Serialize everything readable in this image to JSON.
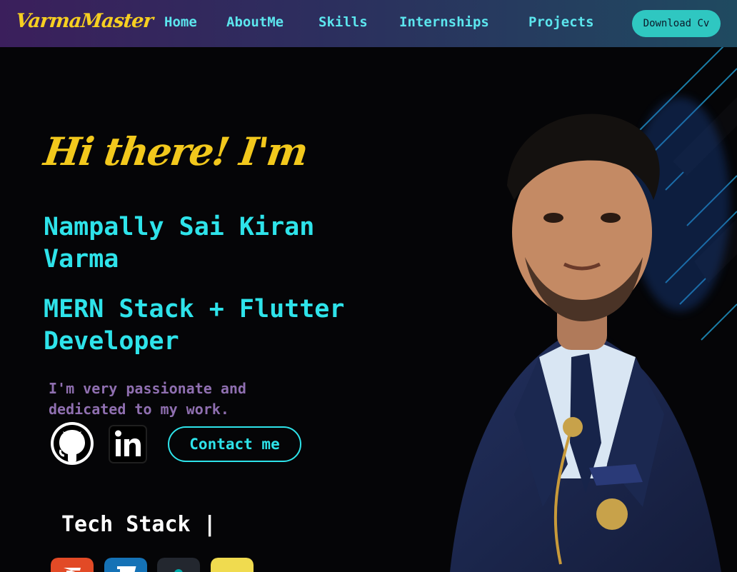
{
  "brand": {
    "logo": "VarmaMaster"
  },
  "nav": {
    "items": [
      "Home",
      "AboutMe",
      "Skills",
      "Internships",
      "Projects"
    ],
    "cv_button": "Download Cv"
  },
  "hero": {
    "greeting": "Hi there! I'm",
    "name": "Nampally Sai Kiran Varma",
    "role": "MERN Stack + Flutter Developer",
    "tagline": "I'm very passionate and dedicated to my work.",
    "contact_button": "Contact me",
    "socials": [
      "github-icon",
      "linkedin-icon"
    ]
  },
  "tech": {
    "title": "Tech Stack |",
    "icons": [
      "html5-icon",
      "css3-icon",
      "dark-icon",
      "javascript-icon"
    ]
  },
  "colors": {
    "accent_cyan": "#2ee3ea",
    "brand_yellow": "#f2c81c",
    "tagline_purple": "#8f6fb0",
    "cv_button": "#2fc7c1",
    "background": "#050507"
  }
}
